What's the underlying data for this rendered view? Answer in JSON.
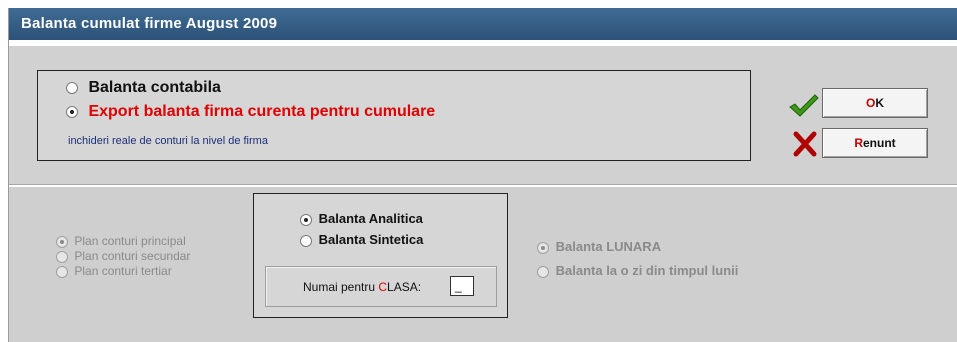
{
  "window": {
    "title": "Balanta cumulat firme August 2009"
  },
  "report_type": {
    "options": [
      {
        "label": "Balanta contabila",
        "checked": false
      },
      {
        "label": "Export balanta firma curenta pentru cumulare",
        "checked": true
      }
    ],
    "hint": "inchideri reale de conturi la nivel de firma"
  },
  "buttons": {
    "ok": {
      "accel": "O",
      "rest": "K"
    },
    "cancel": {
      "accel": "R",
      "rest": "enunt"
    }
  },
  "plan": {
    "options": [
      {
        "label": "Plan conturi principal",
        "checked": true
      },
      {
        "label": "Plan conturi secundar",
        "checked": false
      },
      {
        "label": "Plan conturi tertiar",
        "checked": false
      }
    ]
  },
  "balance_kind": {
    "options": [
      {
        "label": "Balanta Analitica",
        "checked": true
      },
      {
        "label": "Balanta Sintetica",
        "checked": false
      }
    ],
    "clasa": {
      "prefix": "Numai pentru ",
      "accent": "C",
      "rest": "LASA:",
      "value": "_"
    }
  },
  "period": {
    "options": [
      {
        "label": "Balanta LUNARA",
        "checked": true
      },
      {
        "label": "Balanta la o zi din timpul lunii",
        "checked": false
      }
    ]
  },
  "colors": {
    "title_bar": "#2f577f",
    "accent_red": "#e00000",
    "hint_blue": "#1c2f78",
    "check_green": "#3c9a16",
    "cross_red": "#b00000"
  },
  "icons": {
    "ok": "green-checkmark-icon",
    "cancel": "red-cross-icon"
  }
}
